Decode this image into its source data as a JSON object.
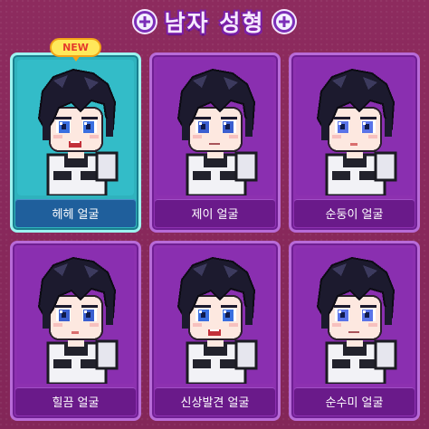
{
  "header": {
    "title": "남자 성형"
  },
  "badge": {
    "new_label": "NEW"
  },
  "faces": [
    {
      "label": "헤헤 얼굴",
      "selected": true,
      "eye_color": "#3a6fe0",
      "mouth": "open"
    },
    {
      "label": "제이 얼굴",
      "selected": false,
      "eye_color": "#3b5fd0",
      "mouth": "flat"
    },
    {
      "label": "순둥이 얼굴",
      "selected": false,
      "eye_color": "#5a74e8",
      "mouth": "small"
    },
    {
      "label": "힐끔 얼굴",
      "selected": false,
      "eye_color": "#3b5fd0",
      "mouth": "small"
    },
    {
      "label": "신상발견 얼굴",
      "selected": false,
      "eye_color": "#3a6fe0",
      "mouth": "open"
    },
    {
      "label": "순수미 얼굴",
      "selected": false,
      "eye_color": "#5a74e8",
      "mouth": "flat"
    }
  ],
  "colors": {
    "background": "#8a2a5c",
    "card_purple": "#8d31b0",
    "card_selected": "#2fb2bd",
    "hair": "#1c1a2e",
    "skin": "#fde8e0"
  }
}
